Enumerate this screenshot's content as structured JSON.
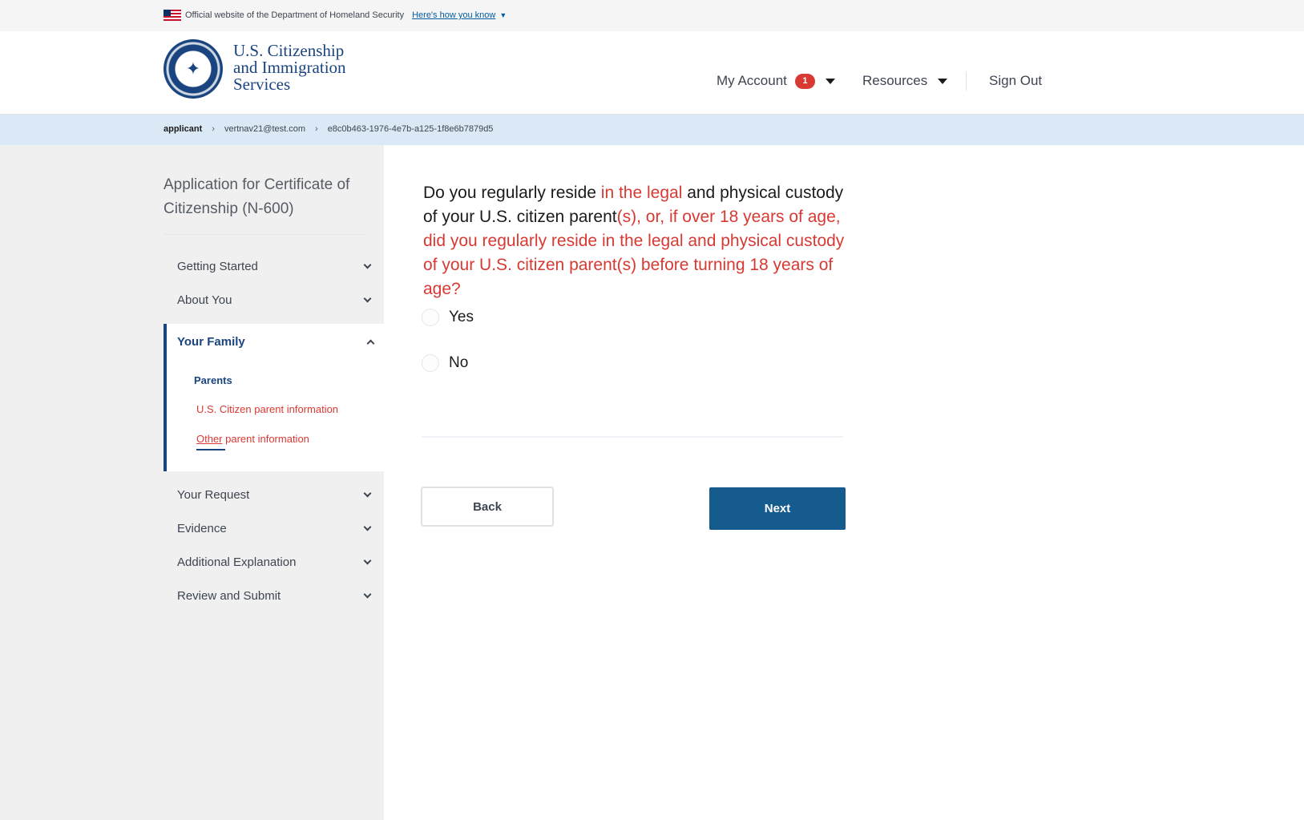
{
  "banner": {
    "official_text": "Official website of the Department of Homeland Security",
    "how_link": "Here's how you know",
    "flag_icon": "us-flag-icon",
    "expand_icon": "chevron-down-icon"
  },
  "header": {
    "agency_line1": "U.S. Citizenship",
    "agency_line2": "and Immigration",
    "agency_line3": "Services",
    "logo_icon": "dhs-seal-icon",
    "nav": {
      "my_account": "My Account",
      "notification_count": "1",
      "resources": "Resources",
      "sign_out": "Sign Out"
    }
  },
  "breadcrumb": {
    "items": [
      "applicant",
      "vertnav21@test.com",
      "e8c0b463-1976-4e7b-a125-1f8e6b7879d5"
    ]
  },
  "sidebar": {
    "application_title": "Application for Certificate of Citizenship (N-600)",
    "sections_top": [
      "Getting Started",
      "About You"
    ],
    "active_section": "Your Family",
    "subitems": {
      "parents": "Parents",
      "us_citizen_parent": "U.S. Citizen parent information",
      "other_word": "Other",
      "other_rest": " parent information"
    },
    "sections_bottom": [
      "Your Request",
      "Evidence",
      "Additional Explanation",
      "Review and Submit"
    ]
  },
  "main": {
    "question": {
      "part1": "Do you regularly reside ",
      "part2": "in the legal",
      "part3": " and physical custody of your U.S. citizen parent",
      "part4": "(s), or, if over 18 years of age, did you regularly reside in the legal and physical custody of your U.S. citizen parent(s) before turning 18 years of age?"
    },
    "options": [
      "Yes",
      "No"
    ],
    "back_label": "Back",
    "next_label": "Next"
  },
  "colors": {
    "primary": "#1a4480",
    "next_button": "#155b8e",
    "highlight": "#d83933",
    "breadcrumb_bg": "#dbe8f6",
    "sidebar_bg": "#f0f0f0"
  }
}
